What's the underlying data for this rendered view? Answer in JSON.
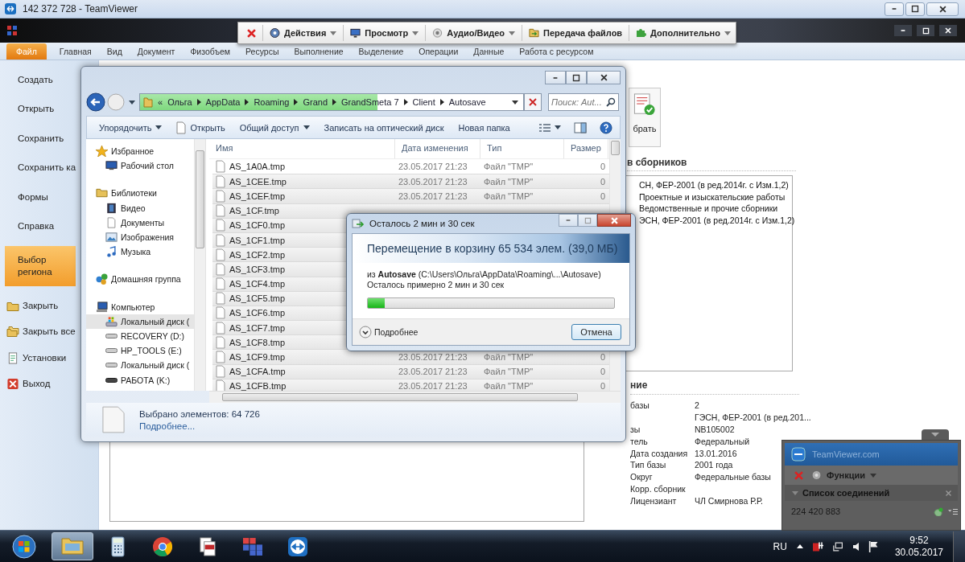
{
  "remote_window": {
    "title": "142 372 728 - TeamViewer"
  },
  "tv_toolbar": {
    "items": [
      {
        "kind": "close"
      },
      {
        "kind": "actions",
        "label": "Действия",
        "dropdown": true
      },
      {
        "kind": "view",
        "label": "Просмотр",
        "dropdown": true
      },
      {
        "kind": "audio",
        "label": "Аудио/Видео",
        "dropdown": true
      },
      {
        "kind": "files",
        "label": "Передача файлов",
        "dropdown": false
      },
      {
        "kind": "extra",
        "label": "Дополнительно",
        "dropdown": true
      }
    ]
  },
  "app": {
    "ribbon_tabs": [
      {
        "label": "Файл",
        "selected": true
      },
      {
        "label": "Главная",
        "selected": false
      },
      {
        "label": "Вид",
        "selected": false
      },
      {
        "label": "Документ",
        "selected": false
      },
      {
        "label": "Физобъем",
        "selected": false
      },
      {
        "label": "Ресурсы",
        "selected": false
      },
      {
        "label": "Выполнение",
        "selected": false
      },
      {
        "label": "Выделение",
        "selected": false
      },
      {
        "label": "Операции",
        "selected": false
      },
      {
        "label": "Данные",
        "selected": false
      },
      {
        "label": "Работа с ресурсом",
        "selected": false
      }
    ],
    "backstage_menu": [
      {
        "label": "Создать",
        "kind": "plain",
        "selected": false
      },
      {
        "label": "Открыть",
        "kind": "plain",
        "selected": false
      },
      {
        "label": "Сохранить",
        "kind": "plain",
        "selected": false
      },
      {
        "label": "Сохранить ка",
        "kind": "plain",
        "selected": false
      },
      {
        "label": "Формы",
        "kind": "plain",
        "selected": false
      },
      {
        "label": "Справка",
        "kind": "plain",
        "selected": false
      },
      {
        "label": "Выбор\nрегиона",
        "kind": "plain",
        "selected": true
      },
      {
        "label": "Закрыть",
        "kind": "folder",
        "selected": false
      },
      {
        "label": "Закрыть все",
        "kind": "folders",
        "selected": false
      },
      {
        "label": "Установки",
        "kind": "settings",
        "selected": false
      },
      {
        "label": "Выход",
        "kind": "exit",
        "selected": false
      }
    ],
    "select_button": {
      "label": "брать"
    },
    "collections": {
      "title": "в сборников",
      "items": [
        {
          "label": "СН, ФЕР-2001 (в ред.2014г. с Изм.1,2)"
        },
        {
          "label": "Проектные и изыскательские работы"
        },
        {
          "label": "Ведомственные и прочие сборники"
        },
        {
          "label": "ЭСН, ФЕР-2001 (в ред.2014г. с Изм.1,2)"
        }
      ]
    },
    "properties": {
      "title": "ние",
      "rows": [
        {
          "label": "базы",
          "value": "2"
        },
        {
          "value": "ГЭСН, ФЕР-2001 (в ред.201..."
        },
        {
          "label": "зы",
          "value": "NB105002"
        },
        {
          "label": "тель",
          "value": "Федеральный"
        },
        {
          "label": "Дата создания",
          "value": "13.01.2016"
        },
        {
          "label": "Тип базы",
          "value": "2001 года"
        },
        {
          "label": "Округ",
          "value": "Федеральные базы"
        },
        {
          "label": "Корр. сборник"
        },
        {
          "label": "Лицензиант",
          "value": "ЧЛ Смирнова Р.Р."
        }
      ]
    }
  },
  "explorer": {
    "address_bar": {
      "level": 0.62,
      "crumbs": [
        "«",
        "Ольга",
        "AppData",
        "Roaming",
        "Grand",
        "GrandSmeta 7",
        "Client",
        "Autosave"
      ]
    },
    "search": {
      "placeholder": "Поиск: Aut..."
    },
    "toolbar": [
      {
        "label": "Упорядочить",
        "dropdown": true
      },
      {
        "label": "Открыть",
        "dropdown": false
      },
      {
        "label": "Общий доступ",
        "dropdown": true
      },
      {
        "label": "Записать на оптический диск",
        "dropdown": false
      },
      {
        "label": "Новая папка",
        "dropdown": false
      }
    ],
    "icon_buttons": [
      {
        "kind": "views"
      },
      {
        "kind": "preview-pane"
      },
      {
        "kind": "help"
      }
    ],
    "nav": [
      {
        "label": "Избранное",
        "kind": "star",
        "selected": false,
        "children": [
          {
            "label": "Рабочий стол",
            "kind": "desktop",
            "selected": false
          }
        ]
      },
      {
        "label": "Библиотеки",
        "kind": "library",
        "selected": false,
        "children": [
          {
            "label": "Видео",
            "kind": "video",
            "selected": false
          },
          {
            "label": "Документы",
            "kind": "documents",
            "selected": false
          },
          {
            "label": "Изображения",
            "kind": "pictures",
            "selected": false
          },
          {
            "label": "Музыка",
            "kind": "music",
            "selected": false
          }
        ]
      },
      {
        "label": "Домашняя группа",
        "kind": "homegroup",
        "selected": false
      },
      {
        "label": "Компьютер",
        "kind": "computer",
        "selected": false,
        "children": [
          {
            "label": "Локальный диск (",
            "kind": "system-drive",
            "selected": true
          },
          {
            "label": "RECOVERY (D:)",
            "kind": "drive",
            "selected": false
          },
          {
            "label": "HP_TOOLS (E:)",
            "kind": "drive",
            "selected": false
          },
          {
            "label": "Локальный диск (",
            "kind": "drive",
            "selected": false
          },
          {
            "label": "РАБОТА (K:)",
            "kind": "net-drive",
            "selected": false
          }
        ]
      }
    ],
    "columns": [
      "Имя",
      "Дата изменения",
      "Тип",
      "Размер"
    ],
    "files": [
      {
        "name": "AS_1A0A.tmp",
        "selected": false,
        "date": "23.05.2017 21:23",
        "type": "Файл \"TMP\"",
        "size": "0"
      },
      {
        "name": "AS_1CEE.tmp",
        "selected": true,
        "date": "23.05.2017 21:23",
        "type": "Файл \"TMP\"",
        "size": "0"
      },
      {
        "name": "AS_1CEF.tmp",
        "selected": true,
        "date": "23.05.2017 21:23",
        "type": "Файл \"TMP\"",
        "size": "0"
      },
      {
        "name": "AS_1CF.tmp",
        "selected": true
      },
      {
        "name": "AS_1CF0.tmp",
        "selected": true
      },
      {
        "name": "AS_1CF1.tmp",
        "selected": true
      },
      {
        "name": "AS_1CF2.tmp",
        "selected": true
      },
      {
        "name": "AS_1CF3.tmp",
        "selected": true
      },
      {
        "name": "AS_1CF4.tmp",
        "selected": true
      },
      {
        "name": "AS_1CF5.tmp",
        "selected": true
      },
      {
        "name": "AS_1CF6.tmp",
        "selected": true
      },
      {
        "name": "AS_1CF7.tmp",
        "selected": true
      },
      {
        "name": "AS_1CF8.tmp",
        "selected": true
      },
      {
        "name": "AS_1CF9.tmp",
        "selected": true,
        "date": "23.05.2017 21:23",
        "type": "Файл \"TMP\"",
        "size": "0"
      },
      {
        "name": "AS_1CFA.tmp",
        "selected": true,
        "date": "23.05.2017 21:23",
        "type": "Файл \"TMP\"",
        "size": "0"
      },
      {
        "name": "AS_1CFB.tmp",
        "selected": true,
        "date": "23.05.2017 21:23",
        "type": "Файл \"TMP\"",
        "size": "0"
      }
    ],
    "details": {
      "summary": "Выбрано элементов: 64 726",
      "link": "Подробнее..."
    }
  },
  "progress_dialog": {
    "title": "Осталось 2 мин и 30 сек",
    "heading": "Перемещение в корзину 65 534 элем. (39,0 МБ)",
    "source": "из **Autosave** (C:\\Users\\Ольга\\AppData\\Roaming\\...\\Autosave)",
    "remaining": "Осталось примерно 2 мин и 30 сек",
    "level": 0.07,
    "more": "Подробнее",
    "cancel": "Отмена"
  },
  "tv_panel": {
    "brand": "TeamViewer.com",
    "functions": "Функции",
    "section": "Список соединений",
    "connections": [
      "224 420 883"
    ]
  },
  "taskbar": {
    "apps": [
      {
        "kind": "explorer",
        "selected": true
      },
      {
        "kind": "calculator",
        "selected": false
      },
      {
        "kind": "chrome",
        "selected": false
      },
      {
        "kind": "pdf",
        "selected": false
      },
      {
        "kind": "grand",
        "selected": false
      },
      {
        "kind": "teamviewer",
        "selected": false
      }
    ],
    "language": "RU",
    "time": "9:52",
    "date": "30.05.2017"
  }
}
